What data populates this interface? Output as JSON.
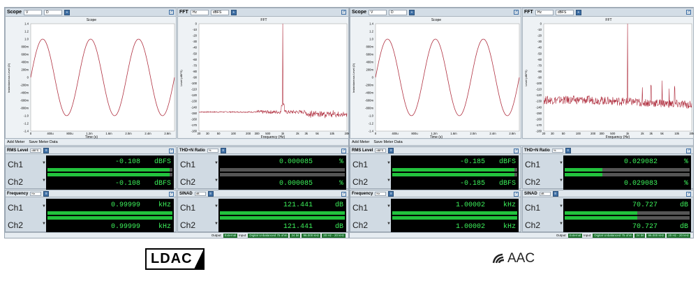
{
  "panels": [
    {
      "scope": {
        "title": "Scope",
        "unit1": "V",
        "unit2": "D",
        "plot_title": "Scope",
        "xlabel": "Time (s)",
        "ylabel": "Instantaneous Level (D)",
        "yticks": [
          "1.4",
          "1.2",
          "1.0",
          "800m",
          "600m",
          "400m",
          "200m",
          "0",
          "-200m",
          "-400m",
          "-600m",
          "-800m",
          "-1.0",
          "-1.2",
          "-1.4"
        ],
        "xticks": [
          "0",
          "400u",
          "800u",
          "1.2m",
          "1.6m",
          "2.0m",
          "2.4m",
          "2.8m"
        ]
      },
      "fft": {
        "title": "FFT",
        "unit1": "Hz",
        "unit2": "dBFS",
        "plot_title": "FFT",
        "xlabel": "Frequency (Hz)",
        "ylabel": "Level (dBFS)",
        "yticks": [
          "0",
          "-10",
          "-20",
          "-30",
          "-40",
          "-50",
          "-60",
          "-70",
          "-80",
          "-90",
          "-100",
          "-110",
          "-120",
          "-130",
          "-140",
          "-150",
          "-160",
          "-170",
          "-180"
        ],
        "xticks": [
          "20",
          "30",
          "50",
          "100",
          "200",
          "300",
          "500",
          "1k",
          "2k",
          "3k",
          "5k",
          "10k",
          "20k"
        ]
      },
      "toolbar": {
        "add": "Add Meter",
        "save": "Save Meter Data"
      },
      "meters": [
        {
          "name": "RMS Level",
          "unit": "dBFS",
          "ch1": "-0.108",
          "ch1_unit": "dBFS",
          "ch2": "-0.108",
          "ch2_unit": "dBFS",
          "fill": 0.98
        },
        {
          "name": "THD+N Ratio",
          "unit": "%",
          "ch1": "0.000085",
          "ch1_unit": "%",
          "ch2": "0.000085",
          "ch2_unit": "%",
          "fill": 0.0
        },
        {
          "name": "Frequency",
          "unit": "Hz",
          "ch1": "0.99999",
          "ch1_unit": "kHz",
          "ch2": "0.99999",
          "ch2_unit": "kHz",
          "fill": 1.0
        },
        {
          "name": "SINAD",
          "unit": "dB",
          "ch1": "121.441",
          "ch1_unit": "dB",
          "ch2": "121.441",
          "ch2_unit": "dB",
          "fill": 1.0
        }
      ],
      "status": {
        "output": "Output:",
        "input": "Input:",
        "s1": "External",
        "s2": "Digital Unbalanced 75 ohm",
        "s3": "24 bit",
        "s4": "96.000 kHz",
        "s5": "20 Hz - 20 kHz"
      }
    },
    {
      "scope": {
        "title": "Scope",
        "unit1": "V",
        "unit2": "D",
        "plot_title": "Scope",
        "xlabel": "Time (s)",
        "ylabel": "Instantaneous Level (D)",
        "yticks": [
          "1.4",
          "1.2",
          "1.0",
          "800m",
          "600m",
          "400m",
          "200m",
          "0",
          "-200m",
          "-400m",
          "-600m",
          "-800m",
          "-1.0",
          "-1.2",
          "-1.4"
        ],
        "xticks": [
          "0",
          "400u",
          "800u",
          "1.2m",
          "1.6m",
          "2.0m",
          "2.4m",
          "2.8m"
        ]
      },
      "fft": {
        "title": "FFT",
        "unit1": "Hz",
        "unit2": "dBFS",
        "plot_title": "FFT",
        "xlabel": "Frequency (Hz)",
        "ylabel": "Level (dBFS)",
        "yticks": [
          "0",
          "-10",
          "-20",
          "-30",
          "-40",
          "-50",
          "-60",
          "-70",
          "-80",
          "-90",
          "-100",
          "-110",
          "-120",
          "-130",
          "-140",
          "-150",
          "-160",
          "-170",
          "-180"
        ],
        "xticks": [
          "20",
          "30",
          "50",
          "100",
          "200",
          "300",
          "500",
          "1k",
          "2k",
          "3k",
          "5k",
          "10k",
          "20k"
        ]
      },
      "toolbar": {
        "add": "Add Meter",
        "save": "Save Meter Data"
      },
      "meters": [
        {
          "name": "RMS Level",
          "unit": "dBFS",
          "ch1": "-0.185",
          "ch1_unit": "dBFS",
          "ch2": "-0.185",
          "ch2_unit": "dBFS",
          "fill": 0.98
        },
        {
          "name": "THD+N Ratio",
          "unit": "%",
          "ch1": "0.029082",
          "ch1_unit": "%",
          "ch2": "0.029083",
          "ch2_unit": "%",
          "fill": 0.3
        },
        {
          "name": "Frequency",
          "unit": "Hz",
          "ch1": "1.00002",
          "ch1_unit": "kHz",
          "ch2": "1.00002",
          "ch2_unit": "kHz",
          "fill": 1.0
        },
        {
          "name": "SINAD",
          "unit": "dB",
          "ch1": "70.727",
          "ch1_unit": "dB",
          "ch2": "70.727",
          "ch2_unit": "dB",
          "fill": 0.58
        }
      ],
      "status": {
        "output": "Output:",
        "input": "Input:",
        "s1": "External",
        "s2": "Digital Unbalanced 75 ohm",
        "s3": "24 bit",
        "s4": "96.000 kHz",
        "s5": "20 Hz - 20 kHz"
      }
    }
  ],
  "logos": {
    "left": "LDAC",
    "right": "AAC"
  },
  "colors": {
    "trace": "#b03040",
    "display_text": "#3df25b",
    "bar": "#22c33d"
  }
}
